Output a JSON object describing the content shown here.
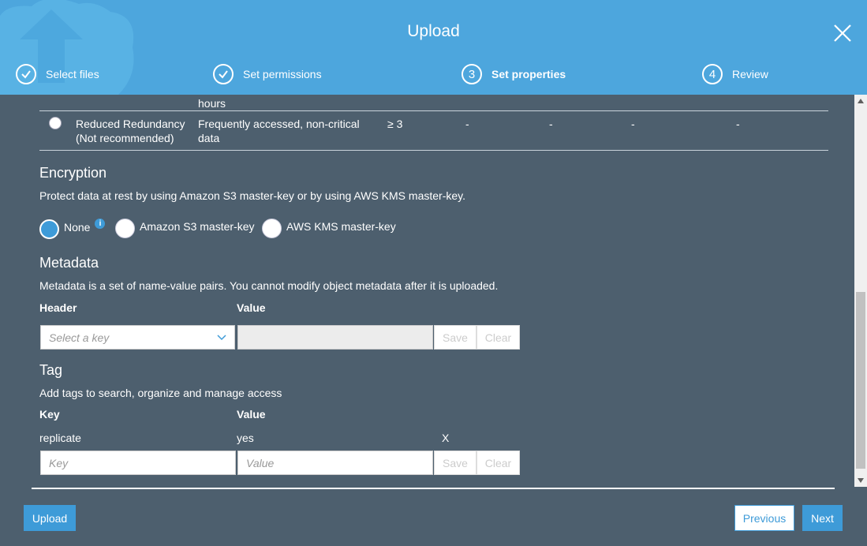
{
  "dialog": {
    "title": "Upload"
  },
  "steps": [
    {
      "label": "Select files",
      "number": "",
      "state": "done"
    },
    {
      "label": "Set permissions",
      "number": "",
      "state": "done"
    },
    {
      "label": "Set properties",
      "number": "3",
      "state": "active"
    },
    {
      "label": "Review",
      "number": "4",
      "state": "pending"
    }
  ],
  "storage_class": {
    "partial_text": "hours",
    "row": {
      "name_line1": "Reduced Redundancy",
      "name_line2": "(Not recommended)",
      "use_line1": "Frequently accessed, non-critical",
      "use_line2": "data",
      "az": "≥ 3",
      "col4": "-",
      "col5": "-",
      "col6": "-",
      "col7": "-"
    }
  },
  "encryption": {
    "title": "Encryption",
    "description": "Protect data at rest by using Amazon S3 master-key or by using AWS KMS master-key.",
    "options": [
      {
        "label": "None",
        "selected": true
      },
      {
        "label": "Amazon S3 master-key",
        "selected": false
      },
      {
        "label": "AWS KMS master-key",
        "selected": false
      }
    ],
    "info_glyph": "i"
  },
  "metadata": {
    "title": "Metadata",
    "description": "Metadata is a set of name-value pairs. You cannot modify object metadata after it is uploaded.",
    "header_col": "Header",
    "value_col": "Value",
    "select_placeholder": "Select a key",
    "save_label": "Save",
    "clear_label": "Clear"
  },
  "tag": {
    "title": "Tag",
    "description": "Add tags to search, organize and manage access",
    "key_col": "Key",
    "value_col": "Value",
    "rows": [
      {
        "key": "replicate",
        "value": "yes",
        "remove": "X"
      }
    ],
    "key_placeholder": "Key",
    "value_placeholder": "Value",
    "save_label": "Save",
    "clear_label": "Clear"
  },
  "footer": {
    "upload_label": "Upload",
    "previous_label": "Previous",
    "next_label": "Next"
  },
  "colors": {
    "header_bg": "#4da6dd",
    "body_bg": "#4d5f6e",
    "accent": "#3e9bd8"
  }
}
